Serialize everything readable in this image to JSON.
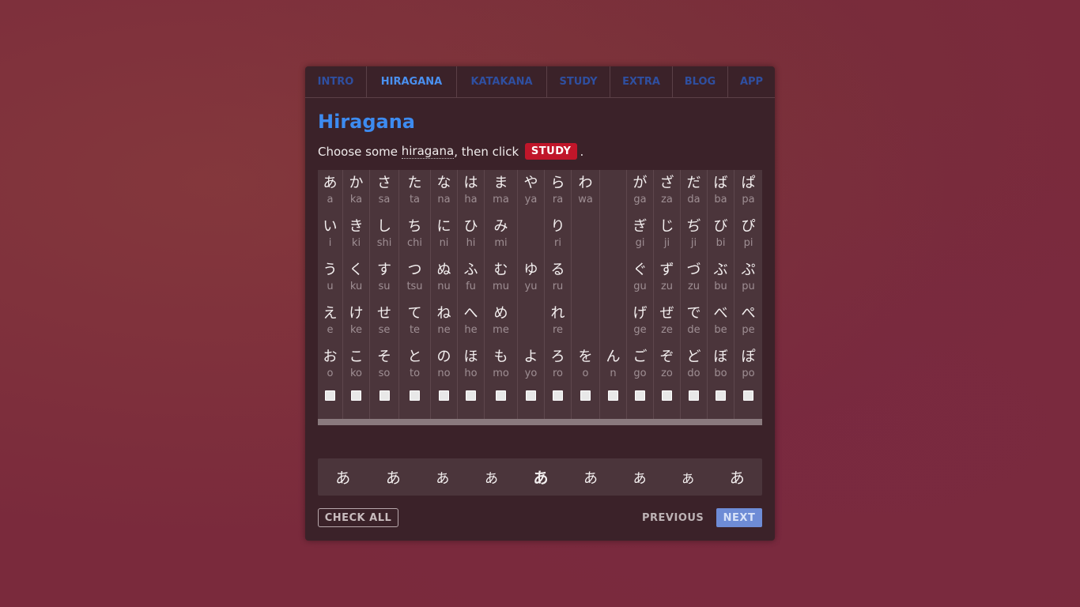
{
  "nav": {
    "tabs": [
      {
        "label": "INTRO",
        "active": false
      },
      {
        "label": "HIRAGANA",
        "active": true
      },
      {
        "label": "KATAKANA",
        "active": false
      },
      {
        "label": "STUDY",
        "active": false
      },
      {
        "label": "EXTRA",
        "active": false
      },
      {
        "label": "BLOG",
        "active": false
      },
      {
        "label": "APP",
        "active": false
      }
    ]
  },
  "main": {
    "title": "Hiragana",
    "instruction_before": "Choose some ",
    "instruction_link": "hiragana",
    "instruction_middle": ", then click ",
    "study_badge": "STUDY",
    "instruction_after": "."
  },
  "colors": {
    "accent": "#3d8bf0",
    "study_badge": "#c0162a",
    "next_button": "#6e8cd6"
  },
  "columns": [
    {
      "rows": [
        [
          "あ",
          "a"
        ],
        [
          "い",
          "i"
        ],
        [
          "う",
          "u"
        ],
        [
          "え",
          "e"
        ],
        [
          "お",
          "o"
        ]
      ],
      "checked": false
    },
    {
      "rows": [
        [
          "か",
          "ka"
        ],
        [
          "き",
          "ki"
        ],
        [
          "く",
          "ku"
        ],
        [
          "け",
          "ke"
        ],
        [
          "こ",
          "ko"
        ]
      ],
      "checked": false
    },
    {
      "rows": [
        [
          "さ",
          "sa"
        ],
        [
          "し",
          "shi"
        ],
        [
          "す",
          "su"
        ],
        [
          "せ",
          "se"
        ],
        [
          "そ",
          "so"
        ]
      ],
      "checked": false
    },
    {
      "rows": [
        [
          "た",
          "ta"
        ],
        [
          "ち",
          "chi"
        ],
        [
          "つ",
          "tsu"
        ],
        [
          "て",
          "te"
        ],
        [
          "と",
          "to"
        ]
      ],
      "checked": false
    },
    {
      "rows": [
        [
          "な",
          "na"
        ],
        [
          "に",
          "ni"
        ],
        [
          "ぬ",
          "nu"
        ],
        [
          "ね",
          "ne"
        ],
        [
          "の",
          "no"
        ]
      ],
      "checked": false
    },
    {
      "rows": [
        [
          "は",
          "ha"
        ],
        [
          "ひ",
          "hi"
        ],
        [
          "ふ",
          "fu"
        ],
        [
          "へ",
          "he"
        ],
        [
          "ほ",
          "ho"
        ]
      ],
      "checked": false
    },
    {
      "rows": [
        [
          "ま",
          "ma"
        ],
        [
          "み",
          "mi"
        ],
        [
          "む",
          "mu"
        ],
        [
          "め",
          "me"
        ],
        [
          "も",
          "mo"
        ]
      ],
      "checked": false
    },
    {
      "rows": [
        [
          "や",
          "ya"
        ],
        [
          "",
          ""
        ],
        [
          "ゆ",
          "yu"
        ],
        [
          "",
          ""
        ],
        [
          "よ",
          "yo"
        ]
      ],
      "checked": false
    },
    {
      "rows": [
        [
          "ら",
          "ra"
        ],
        [
          "り",
          "ri"
        ],
        [
          "る",
          "ru"
        ],
        [
          "れ",
          "re"
        ],
        [
          "ろ",
          "ro"
        ]
      ],
      "checked": false
    },
    {
      "rows": [
        [
          "わ",
          "wa"
        ],
        [
          "",
          ""
        ],
        [
          "",
          ""
        ],
        [
          "",
          ""
        ],
        [
          "を",
          "o"
        ]
      ],
      "checked": false
    },
    {
      "rows": [
        [
          "",
          ""
        ],
        [
          "",
          ""
        ],
        [
          "",
          ""
        ],
        [
          "",
          ""
        ],
        [
          "ん",
          "n"
        ]
      ],
      "checked": false
    },
    {
      "rows": [
        [
          "が",
          "ga"
        ],
        [
          "ぎ",
          "gi"
        ],
        [
          "ぐ",
          "gu"
        ],
        [
          "げ",
          "ge"
        ],
        [
          "ご",
          "go"
        ]
      ],
      "checked": false
    },
    {
      "rows": [
        [
          "ざ",
          "za"
        ],
        [
          "じ",
          "ji"
        ],
        [
          "ず",
          "zu"
        ],
        [
          "ぜ",
          "ze"
        ],
        [
          "ぞ",
          "zo"
        ]
      ],
      "checked": false
    },
    {
      "rows": [
        [
          "だ",
          "da"
        ],
        [
          "ぢ",
          "ji"
        ],
        [
          "づ",
          "zu"
        ],
        [
          "で",
          "de"
        ],
        [
          "ど",
          "do"
        ]
      ],
      "checked": false
    },
    {
      "rows": [
        [
          "ば",
          "ba"
        ],
        [
          "び",
          "bi"
        ],
        [
          "ぶ",
          "bu"
        ],
        [
          "べ",
          "be"
        ],
        [
          "ぼ",
          "bo"
        ]
      ],
      "checked": false
    },
    {
      "rows": [
        [
          "ぱ",
          "pa"
        ],
        [
          "ぴ",
          "pi"
        ],
        [
          "ぷ",
          "pu"
        ],
        [
          "ぺ",
          "pe"
        ],
        [
          "ぽ",
          "po"
        ]
      ],
      "checked": false
    }
  ],
  "font_samples": [
    "あ",
    "あ",
    "あ",
    "あ",
    "あ",
    "あ",
    "あ",
    "あ",
    "あ"
  ],
  "footer": {
    "check_all": "CHECK ALL",
    "previous": "PREVIOUS",
    "next": "NEXT"
  }
}
